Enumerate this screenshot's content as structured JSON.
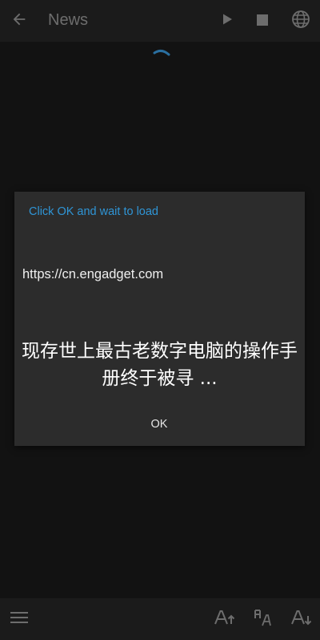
{
  "topbar": {
    "title": "News",
    "icons": [
      "back-arrow-icon",
      "play-icon",
      "stop-icon",
      "globe-icon"
    ]
  },
  "dialog": {
    "title": "Click OK and wait to load",
    "url": "https://cn.engadget.com",
    "headline": "现存世上最古老数字电脑的操作手册终于被寻 ...",
    "ok_label": "OK"
  },
  "bottombar": {
    "icons": [
      "menu-icon",
      "font-size-increase-icon",
      "font-style-icon",
      "font-size-decrease-icon"
    ]
  },
  "colors": {
    "background": "#121212",
    "bar": "#1b1b1b",
    "dialog": "#2c2c2c",
    "accent": "#2f95d6",
    "icon": "#6d6d6d"
  }
}
